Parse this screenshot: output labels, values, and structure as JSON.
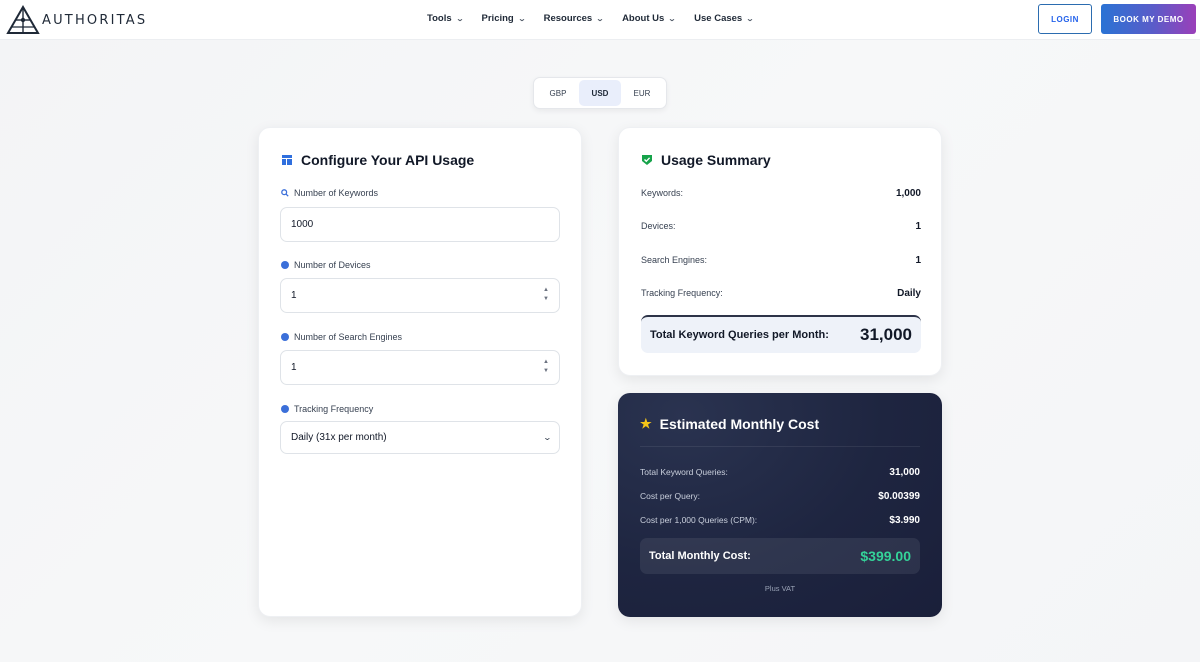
{
  "header": {
    "logo_text": "AUTHORITAS",
    "nav": [
      {
        "label": "Tools"
      },
      {
        "label": "Pricing"
      },
      {
        "label": "Resources"
      },
      {
        "label": "About Us"
      },
      {
        "label": "Use Cases"
      }
    ],
    "login_label": "LOGIN",
    "demo_label": "BOOK MY DEMO"
  },
  "currency": {
    "options": [
      "GBP",
      "USD",
      "EUR"
    ],
    "selected": "USD"
  },
  "config": {
    "title": "Configure Your API Usage",
    "keywords_label": "Number of Keywords",
    "keywords_value": "1000",
    "devices_label": "Number of Devices",
    "devices_value": "1",
    "engines_label": "Number of Search Engines",
    "engines_value": "1",
    "frequency_label": "Tracking Frequency",
    "frequency_value": "Daily (31x per month)"
  },
  "summary": {
    "title": "Usage Summary",
    "rows": [
      {
        "label": "Keywords:",
        "value": "1,000"
      },
      {
        "label": "Devices:",
        "value": "1"
      },
      {
        "label": "Search Engines:",
        "value": "1"
      },
      {
        "label": "Tracking Frequency:",
        "value": "Daily"
      }
    ],
    "total_label": "Total Keyword Queries per Month:",
    "total_value": "31,000"
  },
  "cost": {
    "title": "Estimated Monthly Cost",
    "rows": [
      {
        "label": "Total Keyword Queries:",
        "value": "31,000"
      },
      {
        "label": "Cost per Query:",
        "value": "$0.00399"
      },
      {
        "label": "Cost per 1,000 Queries (CPM):",
        "value": "$3.990"
      }
    ],
    "total_label": "Total Monthly Cost:",
    "total_value": "$399.00",
    "note": "Plus VAT"
  },
  "colors": {
    "accent": "#2563eb",
    "cost_total": "#34d399",
    "cost_card": "#1e2540"
  }
}
